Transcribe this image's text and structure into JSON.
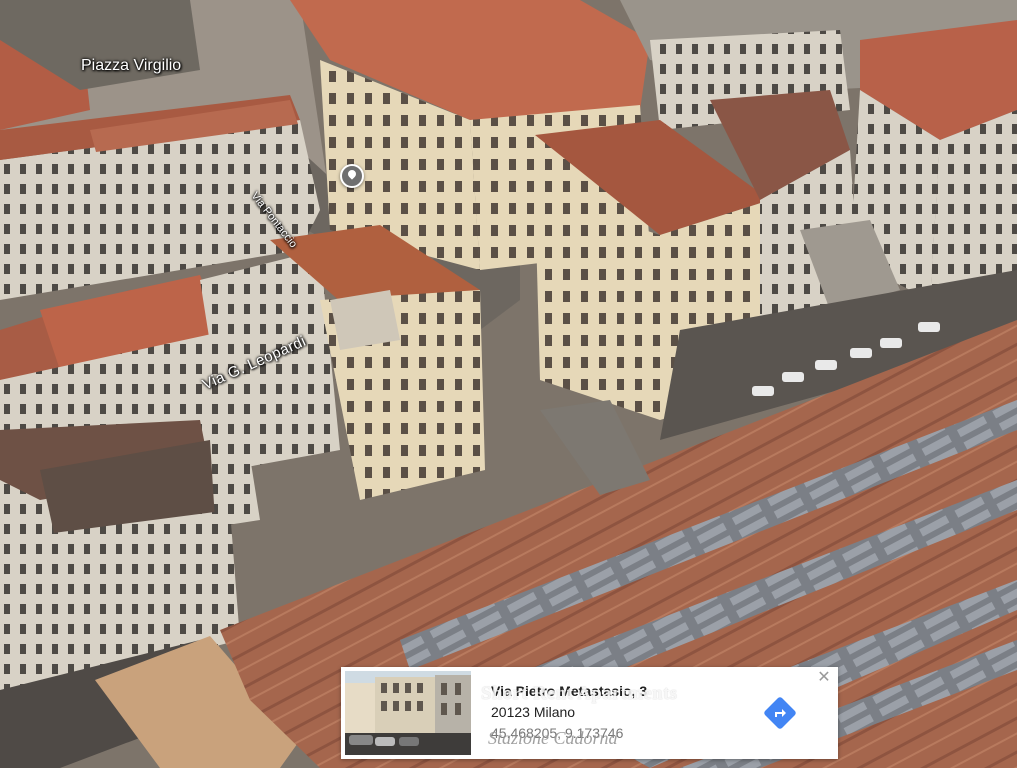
{
  "map": {
    "labels": {
      "piazza": "Piazza Virgilio",
      "street_1": "Via G. Leopardi",
      "street_2": "Via Pontaccio"
    }
  },
  "info_card": {
    "address_line1": "Via Pietro Metastasio, 3",
    "address_line2": "20123 Milano",
    "coordinates": "45.468205, 9.173746",
    "close_icon": "close-icon",
    "directions_icon": "directions-icon"
  },
  "watermark": {
    "title": "Short Rent Apartments",
    "subtitle": "Stazione Cadorna"
  },
  "colors": {
    "directions_blue": "#4285f4",
    "pin_gray": "#6f6f6f"
  }
}
